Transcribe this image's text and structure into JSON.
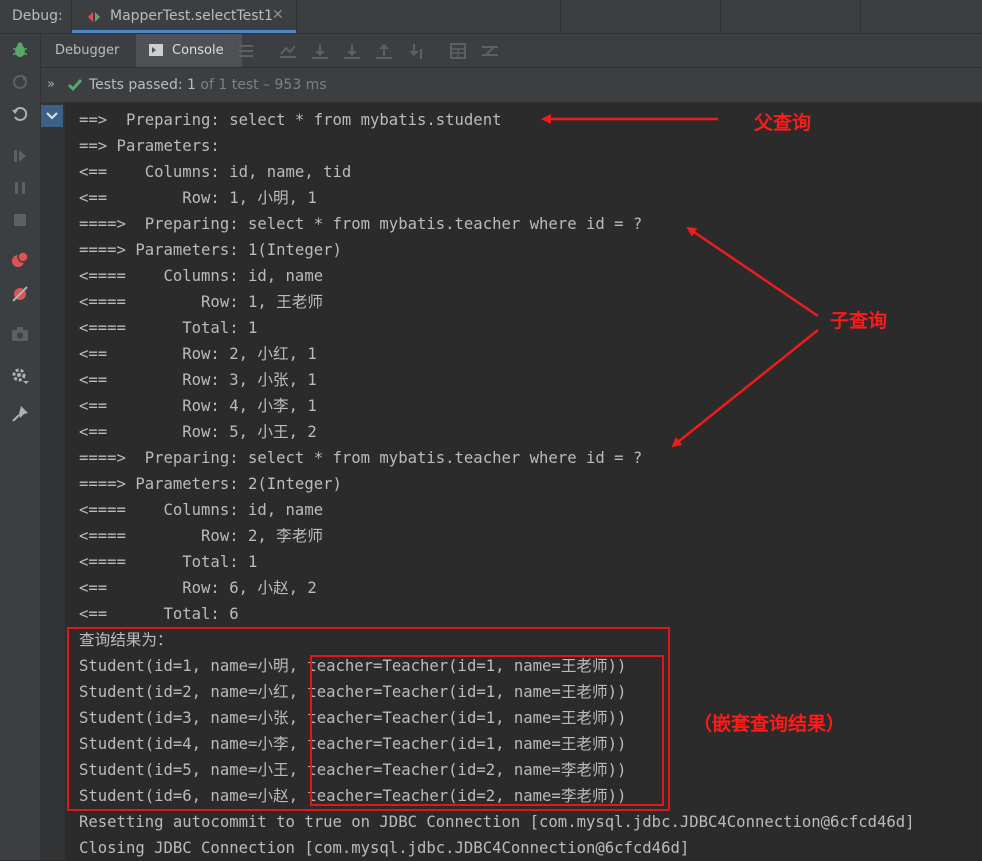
{
  "titlebar": {
    "debug_label": "Debug:",
    "tab_title": "MapperTest.selectTest1",
    "tab_close": "✕"
  },
  "toolbar": {
    "debugger_label": "Debugger",
    "console_label": "Console"
  },
  "tests": {
    "chevron": "»",
    "label": "Tests passed: ",
    "count": "1",
    "rest": " of 1 test – 953 ms"
  },
  "console_lines": [
    "==>  Preparing: select * from mybatis.student",
    "==> Parameters: ",
    "<==    Columns: id, name, tid",
    "<==        Row: 1, 小明, 1",
    "====>  Preparing: select * from mybatis.teacher where id = ?",
    "====> Parameters: 1(Integer)",
    "<====    Columns: id, name",
    "<====        Row: 1, 王老师",
    "<====      Total: 1",
    "<==        Row: 2, 小红, 1",
    "<==        Row: 3, 小张, 1",
    "<==        Row: 4, 小李, 1",
    "<==        Row: 5, 小王, 2",
    "====>  Preparing: select * from mybatis.teacher where id = ?",
    "====> Parameters: 2(Integer)",
    "<====    Columns: id, name",
    "<====        Row: 2, 李老师",
    "<====      Total: 1",
    "<==        Row: 6, 小赵, 2",
    "<==      Total: 6",
    "查询结果为：",
    "Student(id=1, name=小明, teacher=Teacher(id=1, name=王老师))",
    "Student(id=2, name=小红, teacher=Teacher(id=1, name=王老师))",
    "Student(id=3, name=小张, teacher=Teacher(id=1, name=王老师))",
    "Student(id=4, name=小李, teacher=Teacher(id=1, name=王老师))",
    "Student(id=5, name=小王, teacher=Teacher(id=2, name=李老师))",
    "Student(id=6, name=小赵, teacher=Teacher(id=2, name=李老师))",
    "Resetting autocommit to true on JDBC Connection [com.mysql.jdbc.JDBC4Connection@6cfcd46d]",
    "Closing JDBC Connection [com.mysql.jdbc.JDBC4Connection@6cfcd46d]"
  ],
  "annotations": {
    "parent_query": "父查询",
    "sub_query": "子查询",
    "nested_result": "（嵌套查询结果）"
  },
  "colors": {
    "annotation": "#ff1a1a",
    "accent": "#4a88c7",
    "pass_green": "#59a869"
  }
}
